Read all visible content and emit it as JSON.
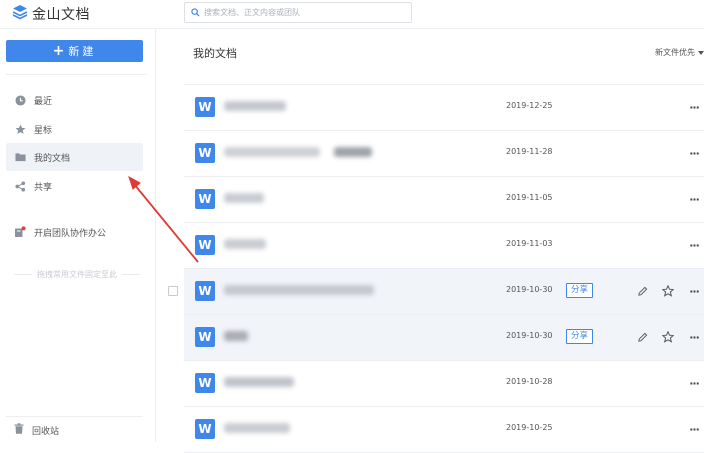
{
  "app": {
    "title": "金山文档"
  },
  "search": {
    "placeholder": "搜索文档、正文内容或团队"
  },
  "sidebar": {
    "new_label": "新建",
    "items": [
      {
        "label": "最近",
        "icon": "clock-icon"
      },
      {
        "label": "星标",
        "icon": "star-icon"
      },
      {
        "label": "我的文档",
        "icon": "folder-icon",
        "active": true
      },
      {
        "label": "共享",
        "icon": "share-icon"
      }
    ],
    "team_label": "开启团队协作办公",
    "drag_hint": "拖拽常用文件固定至此",
    "trash_label": "回收站"
  },
  "main": {
    "title": "我的文档",
    "sort_label": "新文件优先",
    "files": [
      {
        "date": "2019-12-25",
        "shared": false,
        "hover": false
      },
      {
        "date": "2019-11-28",
        "shared": false,
        "hover": false
      },
      {
        "date": "2019-11-05",
        "shared": false,
        "hover": false
      },
      {
        "date": "2019-11-03",
        "shared": false,
        "hover": false
      },
      {
        "date": "2019-10-30",
        "shared": true,
        "share_label": "分享",
        "hover": true
      },
      {
        "date": "2019-10-30",
        "shared": true,
        "share_label": "分享",
        "hover": true
      },
      {
        "date": "2019-10-28",
        "shared": false,
        "hover": false
      },
      {
        "date": "2019-10-25",
        "shared": false,
        "hover": false
      }
    ],
    "more_label": "···"
  },
  "colors": {
    "accent": "#3f87ea",
    "annotation_arrow": "#e03a35"
  }
}
